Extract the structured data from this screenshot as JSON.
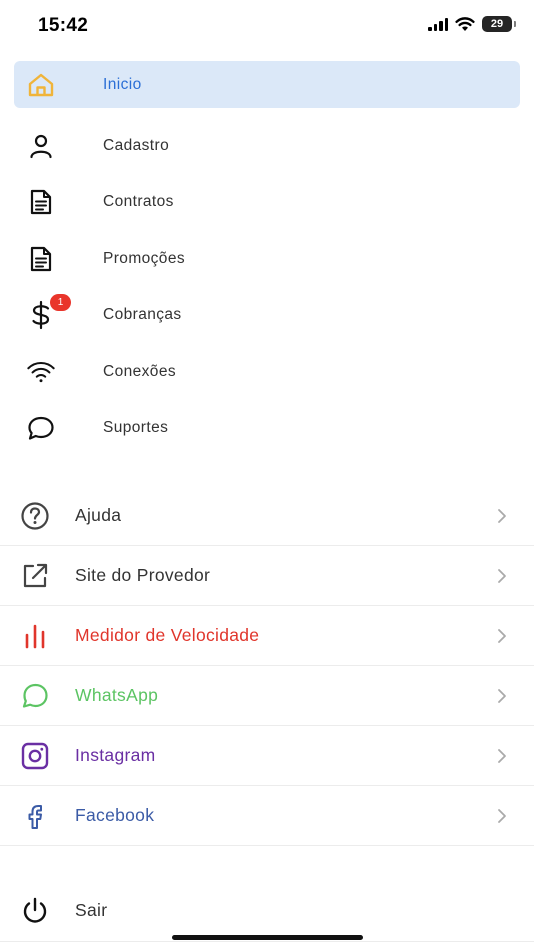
{
  "status": {
    "time": "15:42",
    "battery": "29"
  },
  "menu": {
    "items": [
      {
        "label": "Inicio",
        "icon": "home-icon",
        "active": true
      },
      {
        "label": "Cadastro",
        "icon": "user-icon"
      },
      {
        "label": "Contratos",
        "icon": "document-icon"
      },
      {
        "label": "Promoções",
        "icon": "document-icon"
      },
      {
        "label": "Cobranças",
        "icon": "dollar-icon",
        "badge": "1"
      },
      {
        "label": "Conexões",
        "icon": "wifi-icon"
      },
      {
        "label": "Suportes",
        "icon": "chat-icon"
      }
    ]
  },
  "links": {
    "items": [
      {
        "label": "Ajuda",
        "icon": "help-icon",
        "color": "#333333"
      },
      {
        "label": "Site do Provedor",
        "icon": "external-link-icon",
        "color": "#333333"
      },
      {
        "label": "Medidor de Velocidade",
        "icon": "speed-chart-icon",
        "color": "#e0352b"
      },
      {
        "label": "WhatsApp",
        "icon": "whatsapp-icon",
        "color": "#5cc463"
      },
      {
        "label": "Instagram",
        "icon": "instagram-icon",
        "color": "#6a2fa3"
      },
      {
        "label": "Facebook",
        "icon": "facebook-icon",
        "color": "#3b5ba6"
      }
    ]
  },
  "logout": {
    "label": "Sair",
    "icon": "power-icon"
  },
  "colors": {
    "accent": "#2b6fd6",
    "active_bg": "#dbe8f8",
    "home_icon": "#f0b43a",
    "badge": "#e9352b"
  }
}
